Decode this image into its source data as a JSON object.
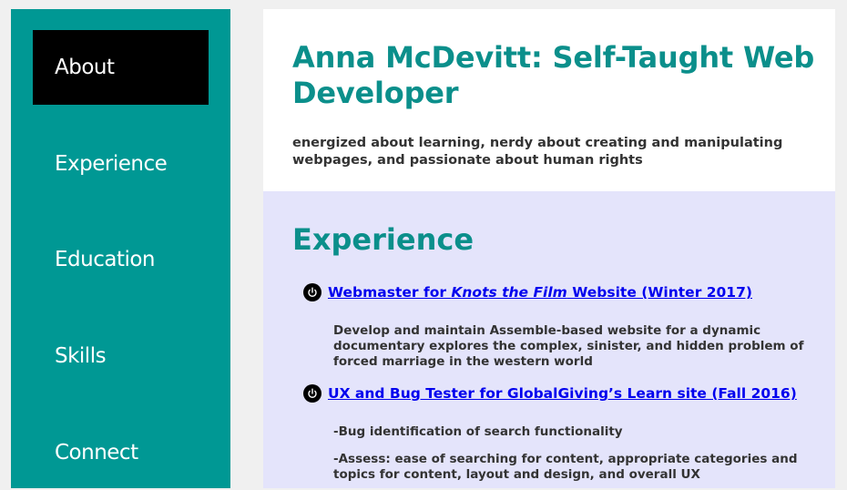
{
  "nav": {
    "items": [
      {
        "label": "About"
      },
      {
        "label": "Experience"
      },
      {
        "label": "Education"
      },
      {
        "label": "Skills"
      },
      {
        "label": "Connect"
      }
    ],
    "active": "About"
  },
  "header": {
    "title": "Anna McDevitt: Self-Taught Web Developer",
    "tagline": "energized about learning, nerdy about creating and manipulating webpages, and passionate about human rights"
  },
  "experience": {
    "heading": "Experience",
    "items": [
      {
        "icon": "power-icon",
        "link_prefix": "Webmaster for ",
        "link_italic": "Knots the Film",
        "link_suffix": " Website (Winter 2017)",
        "descriptions": [
          "Develop and maintain Assemble-based website for a dynamic documentary explores the complex, sinister, and hidden problem of forced marriage in the western world"
        ]
      },
      {
        "icon": "power-icon",
        "link_prefix": "UX and Bug Tester for GlobalGiving’s Learn site (Fall 2016)",
        "descriptions": [
          "-Bug identification of search functionality",
          "-Assess: ease of searching for content, appropriate categories and topics for content, layout and design, and overall UX"
        ]
      }
    ]
  },
  "colors": {
    "teal": "#009894",
    "heading_teal": "#0b8f8b",
    "active_nav": "#000000",
    "section_bg": "#e4e4fb",
    "link": "#0000ee"
  }
}
